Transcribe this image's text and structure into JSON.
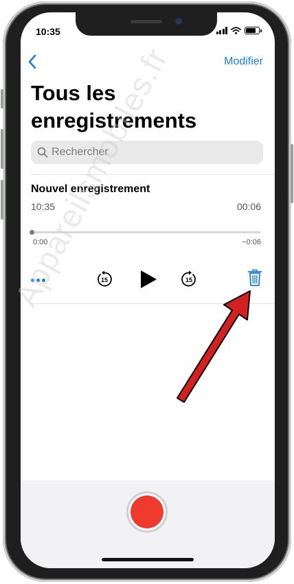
{
  "status_bar": {
    "time": "10:35"
  },
  "nav": {
    "back_icon": "chevron-left-icon",
    "edit_label": "Modifier",
    "accent": "#1a7cd6"
  },
  "page": {
    "title": "Tous les enregistrements"
  },
  "search": {
    "placeholder": "Rechercher",
    "value": ""
  },
  "recording": {
    "title": "Nouvel enregistrement",
    "time": "10:35",
    "duration": "00:06",
    "elapsed": "0:00",
    "remaining": "−0:06",
    "progress": 0
  },
  "controls": {
    "more_icon": "ellipsis-icon",
    "skip_back_label": "15",
    "play_icon": "play-icon",
    "skip_forward_label": "15",
    "trash_icon": "trash-icon",
    "trash_color": "#1a7cd6"
  },
  "record_button": {
    "color": "#f03a30"
  },
  "annotation": {
    "arrow_color": "#d42020",
    "watermark": "Appareilsmobiles.fr"
  }
}
